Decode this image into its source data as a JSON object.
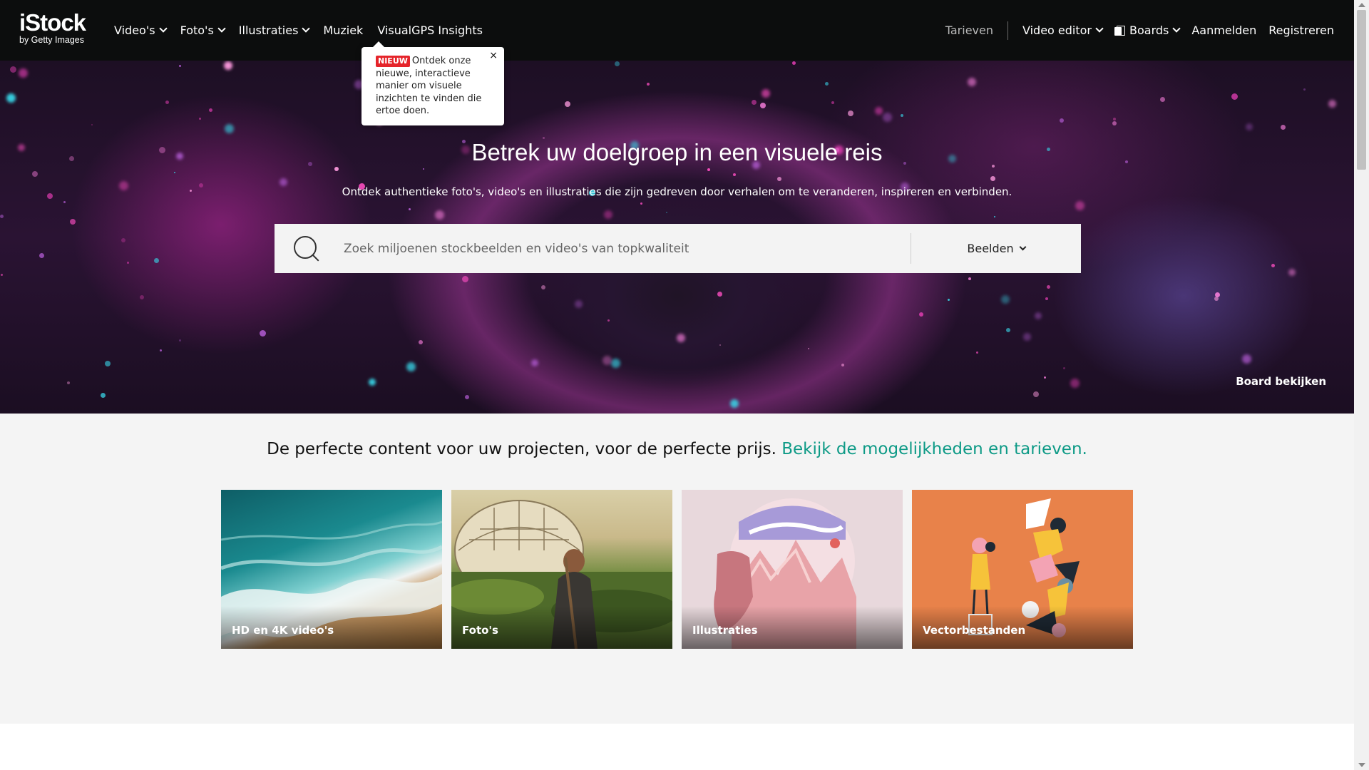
{
  "logo": {
    "word": "iStock",
    "by": "by Getty Images"
  },
  "nav_left": [
    {
      "label": "Video's",
      "has_dropdown": true
    },
    {
      "label": "Foto's",
      "has_dropdown": true
    },
    {
      "label": "Illustraties",
      "has_dropdown": true
    },
    {
      "label": "Muziek",
      "has_dropdown": false
    },
    {
      "label": "VisualGPS Insights",
      "has_dropdown": false
    }
  ],
  "nav_right": {
    "pricing": "Tarieven",
    "video_editor": "Video editor",
    "boards": "Boards",
    "login": "Aanmelden",
    "register": "Registreren"
  },
  "tooltip": {
    "badge": "NIEUW",
    "text": "Ontdek onze nieuwe, interactieve manier om visuele inzichten te vinden die ertoe doen.",
    "close": "×"
  },
  "hero": {
    "title": "Betrek uw doelgroep in een visuele reis",
    "subtitle": "Ontdek authentieke foto's, video's en illustraties die zijn gedreven door verhalen om te veranderen, inspireren en verbinden.",
    "board_link": "Board bekijken"
  },
  "search": {
    "placeholder": "Zoek miljoenen stockbeelden en video's van topkwaliteit",
    "value": "",
    "type_selected": "Beelden"
  },
  "tagline": {
    "text": "De perfecte content voor uw projecten, voor de perfecte prijs.",
    "link": "Bekijk de mogelijkheden en tarieven."
  },
  "cards": [
    {
      "label": "HD en 4K video's"
    },
    {
      "label": "Foto's"
    },
    {
      "label": "Illustraties"
    },
    {
      "label": "Vectorbestanden"
    }
  ],
  "colors": {
    "header_bg": "#0c0d0d",
    "link_green": "#0d9a86",
    "badge_red": "#e5242a",
    "content_bg": "#f4f4f4"
  }
}
